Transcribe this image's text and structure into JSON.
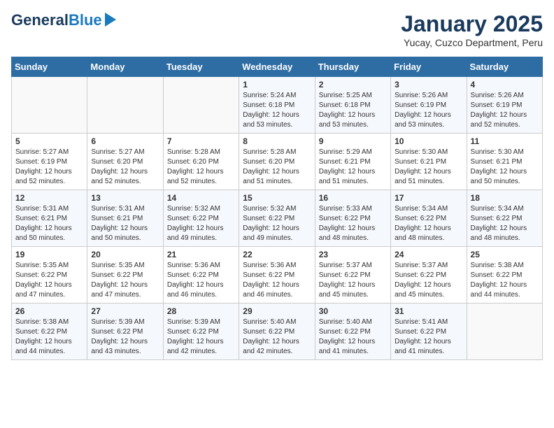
{
  "header": {
    "logo_general": "General",
    "logo_blue": "Blue",
    "title": "January 2025",
    "subtitle": "Yucay, Cuzco Department, Peru"
  },
  "days_of_week": [
    "Sunday",
    "Monday",
    "Tuesday",
    "Wednesday",
    "Thursday",
    "Friday",
    "Saturday"
  ],
  "weeks": [
    [
      {
        "day": "",
        "info": ""
      },
      {
        "day": "",
        "info": ""
      },
      {
        "day": "",
        "info": ""
      },
      {
        "day": "1",
        "info": "Sunrise: 5:24 AM\nSunset: 6:18 PM\nDaylight: 12 hours\nand 53 minutes."
      },
      {
        "day": "2",
        "info": "Sunrise: 5:25 AM\nSunset: 6:18 PM\nDaylight: 12 hours\nand 53 minutes."
      },
      {
        "day": "3",
        "info": "Sunrise: 5:26 AM\nSunset: 6:19 PM\nDaylight: 12 hours\nand 53 minutes."
      },
      {
        "day": "4",
        "info": "Sunrise: 5:26 AM\nSunset: 6:19 PM\nDaylight: 12 hours\nand 52 minutes."
      }
    ],
    [
      {
        "day": "5",
        "info": "Sunrise: 5:27 AM\nSunset: 6:19 PM\nDaylight: 12 hours\nand 52 minutes."
      },
      {
        "day": "6",
        "info": "Sunrise: 5:27 AM\nSunset: 6:20 PM\nDaylight: 12 hours\nand 52 minutes."
      },
      {
        "day": "7",
        "info": "Sunrise: 5:28 AM\nSunset: 6:20 PM\nDaylight: 12 hours\nand 52 minutes."
      },
      {
        "day": "8",
        "info": "Sunrise: 5:28 AM\nSunset: 6:20 PM\nDaylight: 12 hours\nand 51 minutes."
      },
      {
        "day": "9",
        "info": "Sunrise: 5:29 AM\nSunset: 6:21 PM\nDaylight: 12 hours\nand 51 minutes."
      },
      {
        "day": "10",
        "info": "Sunrise: 5:30 AM\nSunset: 6:21 PM\nDaylight: 12 hours\nand 51 minutes."
      },
      {
        "day": "11",
        "info": "Sunrise: 5:30 AM\nSunset: 6:21 PM\nDaylight: 12 hours\nand 50 minutes."
      }
    ],
    [
      {
        "day": "12",
        "info": "Sunrise: 5:31 AM\nSunset: 6:21 PM\nDaylight: 12 hours\nand 50 minutes."
      },
      {
        "day": "13",
        "info": "Sunrise: 5:31 AM\nSunset: 6:21 PM\nDaylight: 12 hours\nand 50 minutes."
      },
      {
        "day": "14",
        "info": "Sunrise: 5:32 AM\nSunset: 6:22 PM\nDaylight: 12 hours\nand 49 minutes."
      },
      {
        "day": "15",
        "info": "Sunrise: 5:32 AM\nSunset: 6:22 PM\nDaylight: 12 hours\nand 49 minutes."
      },
      {
        "day": "16",
        "info": "Sunrise: 5:33 AM\nSunset: 6:22 PM\nDaylight: 12 hours\nand 48 minutes."
      },
      {
        "day": "17",
        "info": "Sunrise: 5:34 AM\nSunset: 6:22 PM\nDaylight: 12 hours\nand 48 minutes."
      },
      {
        "day": "18",
        "info": "Sunrise: 5:34 AM\nSunset: 6:22 PM\nDaylight: 12 hours\nand 48 minutes."
      }
    ],
    [
      {
        "day": "19",
        "info": "Sunrise: 5:35 AM\nSunset: 6:22 PM\nDaylight: 12 hours\nand 47 minutes."
      },
      {
        "day": "20",
        "info": "Sunrise: 5:35 AM\nSunset: 6:22 PM\nDaylight: 12 hours\nand 47 minutes."
      },
      {
        "day": "21",
        "info": "Sunrise: 5:36 AM\nSunset: 6:22 PM\nDaylight: 12 hours\nand 46 minutes."
      },
      {
        "day": "22",
        "info": "Sunrise: 5:36 AM\nSunset: 6:22 PM\nDaylight: 12 hours\nand 46 minutes."
      },
      {
        "day": "23",
        "info": "Sunrise: 5:37 AM\nSunset: 6:22 PM\nDaylight: 12 hours\nand 45 minutes."
      },
      {
        "day": "24",
        "info": "Sunrise: 5:37 AM\nSunset: 6:22 PM\nDaylight: 12 hours\nand 45 minutes."
      },
      {
        "day": "25",
        "info": "Sunrise: 5:38 AM\nSunset: 6:22 PM\nDaylight: 12 hours\nand 44 minutes."
      }
    ],
    [
      {
        "day": "26",
        "info": "Sunrise: 5:38 AM\nSunset: 6:22 PM\nDaylight: 12 hours\nand 44 minutes."
      },
      {
        "day": "27",
        "info": "Sunrise: 5:39 AM\nSunset: 6:22 PM\nDaylight: 12 hours\nand 43 minutes."
      },
      {
        "day": "28",
        "info": "Sunrise: 5:39 AM\nSunset: 6:22 PM\nDaylight: 12 hours\nand 42 minutes."
      },
      {
        "day": "29",
        "info": "Sunrise: 5:40 AM\nSunset: 6:22 PM\nDaylight: 12 hours\nand 42 minutes."
      },
      {
        "day": "30",
        "info": "Sunrise: 5:40 AM\nSunset: 6:22 PM\nDaylight: 12 hours\nand 41 minutes."
      },
      {
        "day": "31",
        "info": "Sunrise: 5:41 AM\nSunset: 6:22 PM\nDaylight: 12 hours\nand 41 minutes."
      },
      {
        "day": "",
        "info": ""
      }
    ]
  ]
}
